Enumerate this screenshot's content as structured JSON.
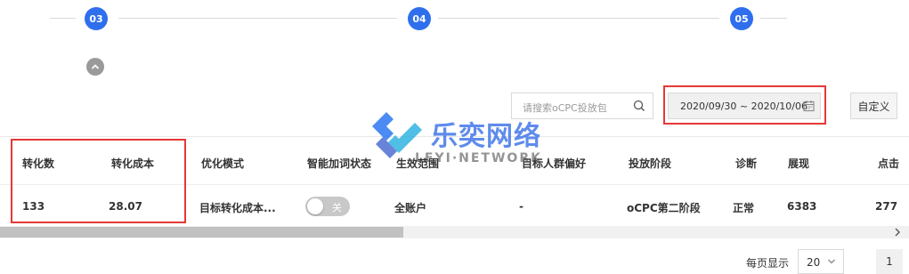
{
  "stepper": {
    "steps": [
      {
        "num": "03"
      },
      {
        "num": "04"
      },
      {
        "num": "05"
      }
    ]
  },
  "toolbar": {
    "search_placeholder": "请搜索oCPC投放包",
    "date_range": "2020/09/30 ~ 2020/10/06",
    "custom_label": "自定义"
  },
  "table": {
    "headers": [
      "转化数",
      "转化成本",
      "优化模式",
      "智能加词状态",
      "生效范围",
      "目标人群偏好",
      "投放阶段",
      "诊断",
      "展现",
      "点击"
    ],
    "row": {
      "conversions": "133",
      "conversion_cost": "28.07",
      "optimize_mode": "目标转化成本...",
      "smart_keyword_toggle_label": "关",
      "scope": "全账户",
      "audience_pref": "-",
      "stage": "oCPC第二阶段",
      "diagnosis": "正常",
      "impressions": "6383",
      "clicks": "277"
    }
  },
  "pagination": {
    "per_page_label": "每页显示",
    "per_page_value": "20",
    "current_page": "1"
  },
  "watermark": {
    "cn": "乐奕网络",
    "en": "LEYI·NETWORK"
  },
  "colors": {
    "accent": "#2f6fed",
    "highlight_box": "#e53935"
  },
  "icons": [
    "chevron-up-icon",
    "search-icon",
    "calendar-icon",
    "chevron-right-icon",
    "chevron-down-icon",
    "logo-icon"
  ]
}
